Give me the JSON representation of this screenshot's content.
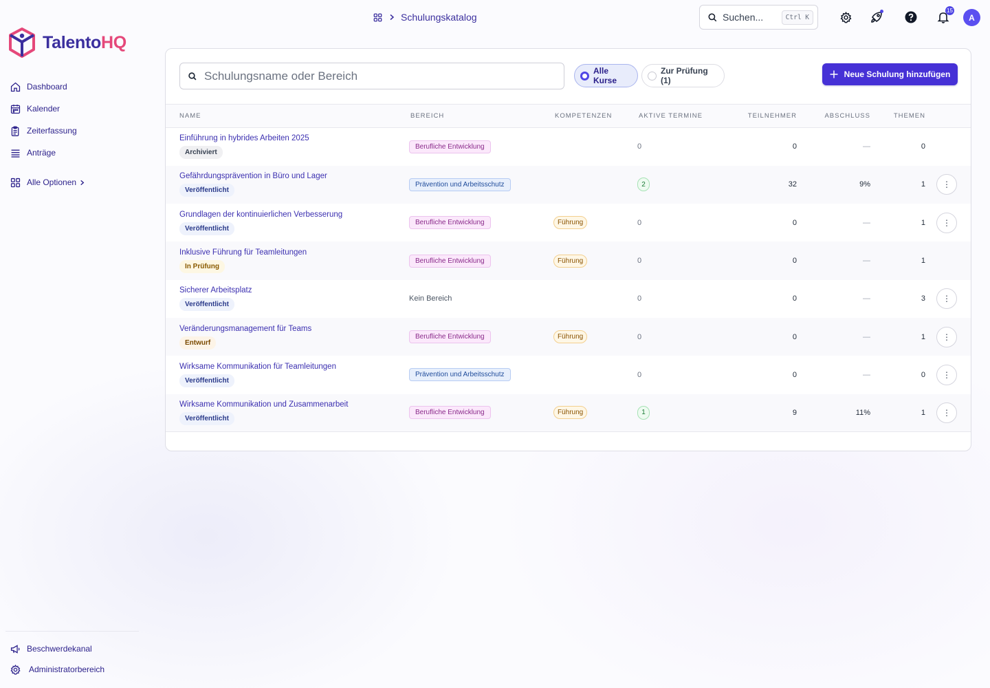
{
  "app": {
    "logo_main": "Talento",
    "logo_accent": "HQ"
  },
  "sidebar": {
    "items": [
      {
        "label": "Dashboard",
        "icon": "home-icon"
      },
      {
        "label": "Kalender",
        "icon": "calendar-icon"
      },
      {
        "label": "Zeiterfassung",
        "icon": "clipboard-icon"
      },
      {
        "label": "Anträge",
        "icon": "list-icon"
      }
    ],
    "more": {
      "label": "Alle Optionen",
      "icon": "grid-icon"
    },
    "bottom": [
      {
        "label": "Beschwerdekanal",
        "icon": "megaphone-icon"
      },
      {
        "label": "Administratorbereich",
        "icon": "gear-icon"
      }
    ]
  },
  "header": {
    "breadcrumb": "Schulungskatalog",
    "search_placeholder": "Suchen...",
    "search_shortcut": "Ctrl K",
    "notifications_count": "15",
    "avatar_initial": "A"
  },
  "catalog": {
    "search_placeholder": "Schulungsname oder Bereich",
    "filters": {
      "all": "Alle Kurse",
      "review": "Zur Prüfung (1)"
    },
    "add_button": "Neue Schulung hinzufügen",
    "columns": [
      "NAME",
      "BEREICH",
      "KOMPETENZEN",
      "AKTIVE TERMINE",
      "TEILNEHMER",
      "ABSCHLUSS",
      "THEMEN"
    ],
    "rows": [
      {
        "name": "Einführung in hybrides Arbeiten 2025",
        "status": "Archiviert",
        "status_kind": "archived",
        "area": "Berufliche Entwicklung",
        "area_kind": "pe",
        "competence": "",
        "active": "0",
        "active_kind": "plain",
        "participants": "0",
        "completion": "—",
        "topics": "0",
        "menu": false
      },
      {
        "name": "Gefährdungsprävention in Büro und Lager",
        "status": "Veröffentlicht",
        "status_kind": "published",
        "area": "Prävention und Arbeitsschutz",
        "area_kind": "pa",
        "competence": "",
        "active": "2",
        "active_kind": "pill",
        "participants": "32",
        "completion": "9%",
        "topics": "1",
        "menu": true
      },
      {
        "name": "Grundlagen der kontinuierlichen Verbesserung",
        "status": "Veröffentlicht",
        "status_kind": "published",
        "area": "Berufliche Entwicklung",
        "area_kind": "pe",
        "competence": "Führung",
        "active": "0",
        "active_kind": "plain",
        "participants": "0",
        "completion": "—",
        "topics": "1",
        "menu": true
      },
      {
        "name": "Inklusive Führung für Teamleitungen",
        "status": "In Prüfung",
        "status_kind": "review",
        "area": "Berufliche Entwicklung",
        "area_kind": "pe",
        "competence": "Führung",
        "active": "0",
        "active_kind": "plain",
        "participants": "0",
        "completion": "—",
        "topics": "1",
        "menu": false
      },
      {
        "name": "Sicherer Arbeitsplatz",
        "status": "Veröffentlicht",
        "status_kind": "published",
        "area": "Kein Bereich",
        "area_kind": "none",
        "competence": "",
        "active": "0",
        "active_kind": "plain",
        "participants": "0",
        "completion": "—",
        "topics": "3",
        "menu": true
      },
      {
        "name": "Veränderungsmanagement für Teams",
        "status": "Entwurf",
        "status_kind": "draft",
        "area": "Berufliche Entwicklung",
        "area_kind": "pe",
        "competence": "Führung",
        "active": "0",
        "active_kind": "plain",
        "participants": "0",
        "completion": "—",
        "topics": "1",
        "menu": true
      },
      {
        "name": "Wirksame Kommunikation für Teamleitungen",
        "status": "Veröffentlicht",
        "status_kind": "published",
        "area": "Prävention und Arbeitsschutz",
        "area_kind": "pa",
        "competence": "",
        "active": "0",
        "active_kind": "plain",
        "participants": "0",
        "completion": "—",
        "topics": "0",
        "menu": true
      },
      {
        "name": "Wirksame Kommunikation und Zusammenarbeit",
        "status": "Veröffentlicht",
        "status_kind": "published",
        "area": "Berufliche Entwicklung",
        "area_kind": "pe",
        "competence": "Führung",
        "active": "1",
        "active_kind": "pill",
        "participants": "9",
        "completion": "11%",
        "topics": "1",
        "menu": true
      }
    ]
  },
  "colors": {
    "brand": "#3b2f9e",
    "accent": "#e5487a",
    "primary_button": "#4631d6"
  }
}
